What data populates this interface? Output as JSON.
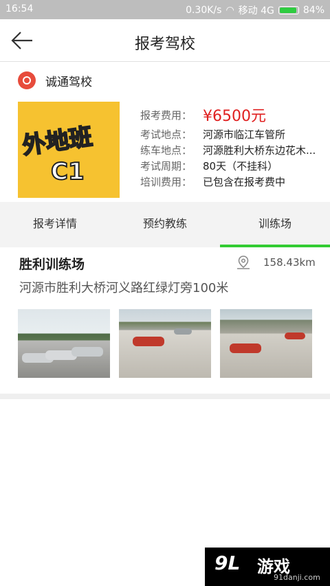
{
  "status_bar": {
    "time": "16:54",
    "speed": "0.30K/s",
    "carrier": "移动 4G",
    "battery": "84%"
  },
  "header": {
    "title": "报考驾校"
  },
  "school": {
    "name": "诚通驾校",
    "poster": {
      "line1": "外地班",
      "line2": "C1"
    },
    "info": [
      {
        "label": "报考费用：",
        "value": "¥6500元"
      },
      {
        "label": "考试地点：",
        "value": "河源市临江车管所"
      },
      {
        "label": "练车地点：",
        "value": "河源胜利大桥东边花木..."
      },
      {
        "label": "考试周期：",
        "value": "80天（不挂科）"
      },
      {
        "label": "培训费用：",
        "value": "已包含在报考费中"
      }
    ]
  },
  "tabs": [
    {
      "label": "报考详情",
      "active": false
    },
    {
      "label": "预约教练",
      "active": false
    },
    {
      "label": "训练场",
      "active": true
    }
  ],
  "training_field": {
    "name": "胜利训练场",
    "distance": "158.43km",
    "address": "河源市胜利大桥河义路红绿灯旁100米"
  },
  "watermark": {
    "brand": "游戏",
    "mark": "9L",
    "url": "91danji.com"
  },
  "colors": {
    "price": "#e02020",
    "active_tab": "#33cc33",
    "status_bar": "#bdbdbd"
  }
}
